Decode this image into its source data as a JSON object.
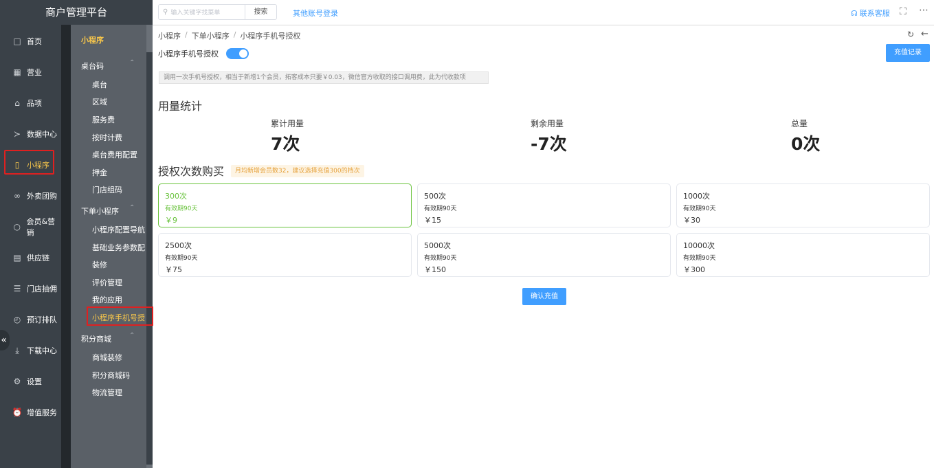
{
  "app": {
    "title": "商户管理平台"
  },
  "nav1": [
    {
      "label": "首页",
      "icon": "home-icon"
    },
    {
      "label": "营业",
      "icon": "calendar-icon"
    },
    {
      "label": "品项",
      "icon": "bag-icon"
    },
    {
      "label": "数据中心",
      "icon": "share-icon"
    },
    {
      "label": "小程序",
      "icon": "phone-icon",
      "active": true
    },
    {
      "label": "外卖团购",
      "icon": "bike-icon"
    },
    {
      "label": "会员&营销",
      "icon": "user-icon"
    },
    {
      "label": "供应链",
      "icon": "truck-icon"
    },
    {
      "label": "门店抽佣",
      "icon": "database-icon"
    },
    {
      "label": "预订排队",
      "icon": "clock-icon"
    },
    {
      "label": "下载中心",
      "icon": "download-icon"
    },
    {
      "label": "设置",
      "icon": "gear-icon"
    },
    {
      "label": "增值服务",
      "icon": "alarm-icon"
    }
  ],
  "nav2": {
    "title": "小程序",
    "groups": [
      {
        "label": "桌台码",
        "items": [
          "桌台",
          "区域",
          "服务费",
          "按时计费",
          "桌台费用配置",
          "押金",
          "门店组码"
        ]
      },
      {
        "label": "下单小程序",
        "items": [
          "小程序配置导航",
          "基础业务参数配",
          "装修",
          "评价管理",
          "我的应用",
          "小程序手机号授"
        ]
      },
      {
        "label": "积分商城",
        "items": [
          "商城装修",
          "积分商城码",
          "物流管理"
        ]
      }
    ]
  },
  "topbar": {
    "search_placeholder": "输入关键字找菜单",
    "search_button": "搜索",
    "other_login": "其他账号登录",
    "contact": "联系客服"
  },
  "breadcrumb": [
    "小程序",
    "下单小程序",
    "小程序手机号授权"
  ],
  "auth": {
    "toggle_label": "小程序手机号授权",
    "enabled": true,
    "record_button": "充值记录",
    "notice": "调用一次手机号授权，相当于新增1个会员，拓客成本只要￥0.03，微信官方收取的接口调用费，此为代收款项"
  },
  "usage": {
    "title": "用量统计",
    "stats": [
      {
        "label": "累计用量",
        "value": "7次"
      },
      {
        "label": "剩余用量",
        "value": "-7次"
      },
      {
        "label": "总量",
        "value": "0次"
      }
    ]
  },
  "purchase": {
    "title": "授权次数购买",
    "tip": "月均新增会员数32，建议选择充值300的档次",
    "packages": [
      {
        "name": "300次",
        "valid": "有效期90天",
        "price": "￥9",
        "selected": true
      },
      {
        "name": "500次",
        "valid": "有效期90天",
        "price": "￥15"
      },
      {
        "name": "1000次",
        "valid": "有效期90天",
        "price": "￥30"
      },
      {
        "name": "2500次",
        "valid": "有效期90天",
        "price": "￥75"
      },
      {
        "name": "5000次",
        "valid": "有效期90天",
        "price": "￥150"
      },
      {
        "name": "10000次",
        "valid": "有效期90天",
        "price": "￥300"
      }
    ],
    "confirm_button": "确认充值"
  },
  "colors": {
    "primary": "#409eff",
    "selected": "#67c23a",
    "nav_active": "#f7c64b",
    "highlight_border": "#e02020"
  }
}
